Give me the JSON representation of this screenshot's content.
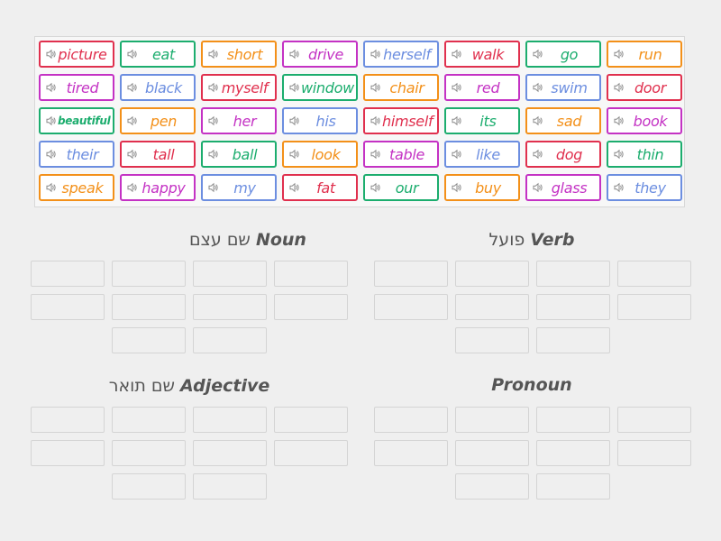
{
  "word_bank": {
    "tiles": [
      {
        "word": "picture",
        "color": "#e0304e"
      },
      {
        "word": "eat",
        "color": "#1cad6e"
      },
      {
        "word": "short",
        "color": "#f39019"
      },
      {
        "word": "drive",
        "color": "#c432c4"
      },
      {
        "word": "herself",
        "color": "#6c8ee0"
      },
      {
        "word": "walk",
        "color": "#e0304e"
      },
      {
        "word": "go",
        "color": "#1cad6e"
      },
      {
        "word": "run",
        "color": "#f39019"
      },
      {
        "word": "tired",
        "color": "#c432c4"
      },
      {
        "word": "black",
        "color": "#6c8ee0"
      },
      {
        "word": "myself",
        "color": "#e0304e"
      },
      {
        "word": "window",
        "color": "#1cad6e"
      },
      {
        "word": "chair",
        "color": "#f39019"
      },
      {
        "word": "red",
        "color": "#c432c4"
      },
      {
        "word": "swim",
        "color": "#6c8ee0"
      },
      {
        "word": "door",
        "color": "#e0304e"
      },
      {
        "word": "beautiful",
        "color": "#1cad6e"
      },
      {
        "word": "pen",
        "color": "#f39019"
      },
      {
        "word": "her",
        "color": "#c432c4"
      },
      {
        "word": "his",
        "color": "#6c8ee0"
      },
      {
        "word": "himself",
        "color": "#e0304e"
      },
      {
        "word": "its",
        "color": "#1cad6e"
      },
      {
        "word": "sad",
        "color": "#f39019"
      },
      {
        "word": "book",
        "color": "#c432c4"
      },
      {
        "word": "their",
        "color": "#6c8ee0"
      },
      {
        "word": "tall",
        "color": "#e0304e"
      },
      {
        "word": "ball",
        "color": "#1cad6e"
      },
      {
        "word": "look",
        "color": "#f39019"
      },
      {
        "word": "table",
        "color": "#c432c4"
      },
      {
        "word": "like",
        "color": "#6c8ee0"
      },
      {
        "word": "dog",
        "color": "#e0304e"
      },
      {
        "word": "thin",
        "color": "#1cad6e"
      },
      {
        "word": "speak",
        "color": "#f39019"
      },
      {
        "word": "happy",
        "color": "#c432c4"
      },
      {
        "word": "my",
        "color": "#6c8ee0"
      },
      {
        "word": "fat",
        "color": "#e0304e"
      },
      {
        "word": "our",
        "color": "#1cad6e"
      },
      {
        "word": "buy",
        "color": "#f39019"
      },
      {
        "word": "glass",
        "color": "#c432c4"
      },
      {
        "word": "they",
        "color": "#6c8ee0"
      }
    ]
  },
  "groups": {
    "noun": {
      "label_en": "Noun",
      "label_he": "שם עצם"
    },
    "verb": {
      "label_en": "Verb",
      "label_he": "פועל"
    },
    "adjective": {
      "label_en": "Adjective",
      "label_he": "שם תואר"
    },
    "pronoun": {
      "label_en": "Pronoun",
      "label_he": ""
    }
  },
  "colors": {
    "red": "#e0304e",
    "green": "#1cad6e",
    "orange": "#f39019",
    "magenta": "#c432c4",
    "blue": "#6c8ee0"
  }
}
